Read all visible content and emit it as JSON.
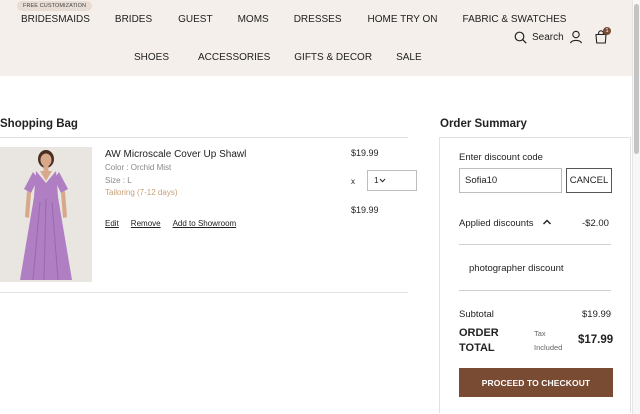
{
  "header": {
    "promo_badge": "FREE CUSTOMIZATION",
    "nav_row1": [
      "BRIDESMAIDS",
      "BRIDES",
      "GUEST",
      "MOMS",
      "DRESSES",
      "HOME TRY ON",
      "FABRIC & SWATCHES"
    ],
    "nav_row2": [
      "SHOES",
      "ACCESSORIES",
      "GIFTS & DECOR",
      "SALE"
    ],
    "search_label": "Search",
    "bag_count": "1"
  },
  "bag": {
    "title": "Shopping Bag",
    "item": {
      "name": "AW Microscale Cover Up Shawl",
      "color": "Color : Orchid Mist",
      "size": "Size : L",
      "tailoring": "Tailoring (7-12 days)",
      "links": [
        "Edit",
        "Remove",
        "Add to Showroom"
      ],
      "unit_price": "$19.99",
      "qty_x": "x",
      "qty": "1",
      "line_total": "$19.99"
    }
  },
  "summary": {
    "title": "Order Summary",
    "discount_label": "Enter discount code",
    "discount_value": "Sofia10",
    "cancel_label": "CANCEL",
    "applied_label": "Applied discounts",
    "applied_amount": "-$2.00",
    "discount_name": "photographer discount",
    "subtotal_label": "Subtotal",
    "subtotal_value": "$19.99",
    "order_total_label": "ORDER TOTAL",
    "tax_note": "Tax Included",
    "total_value": "$17.99",
    "checkout_label": "PROCEED TO CHECKOUT"
  },
  "colors": {
    "header_bg": "#f4efea",
    "brand_brown": "#7a4b33",
    "tailoring_text": "#c7a078",
    "dress": "#b07ec2"
  }
}
